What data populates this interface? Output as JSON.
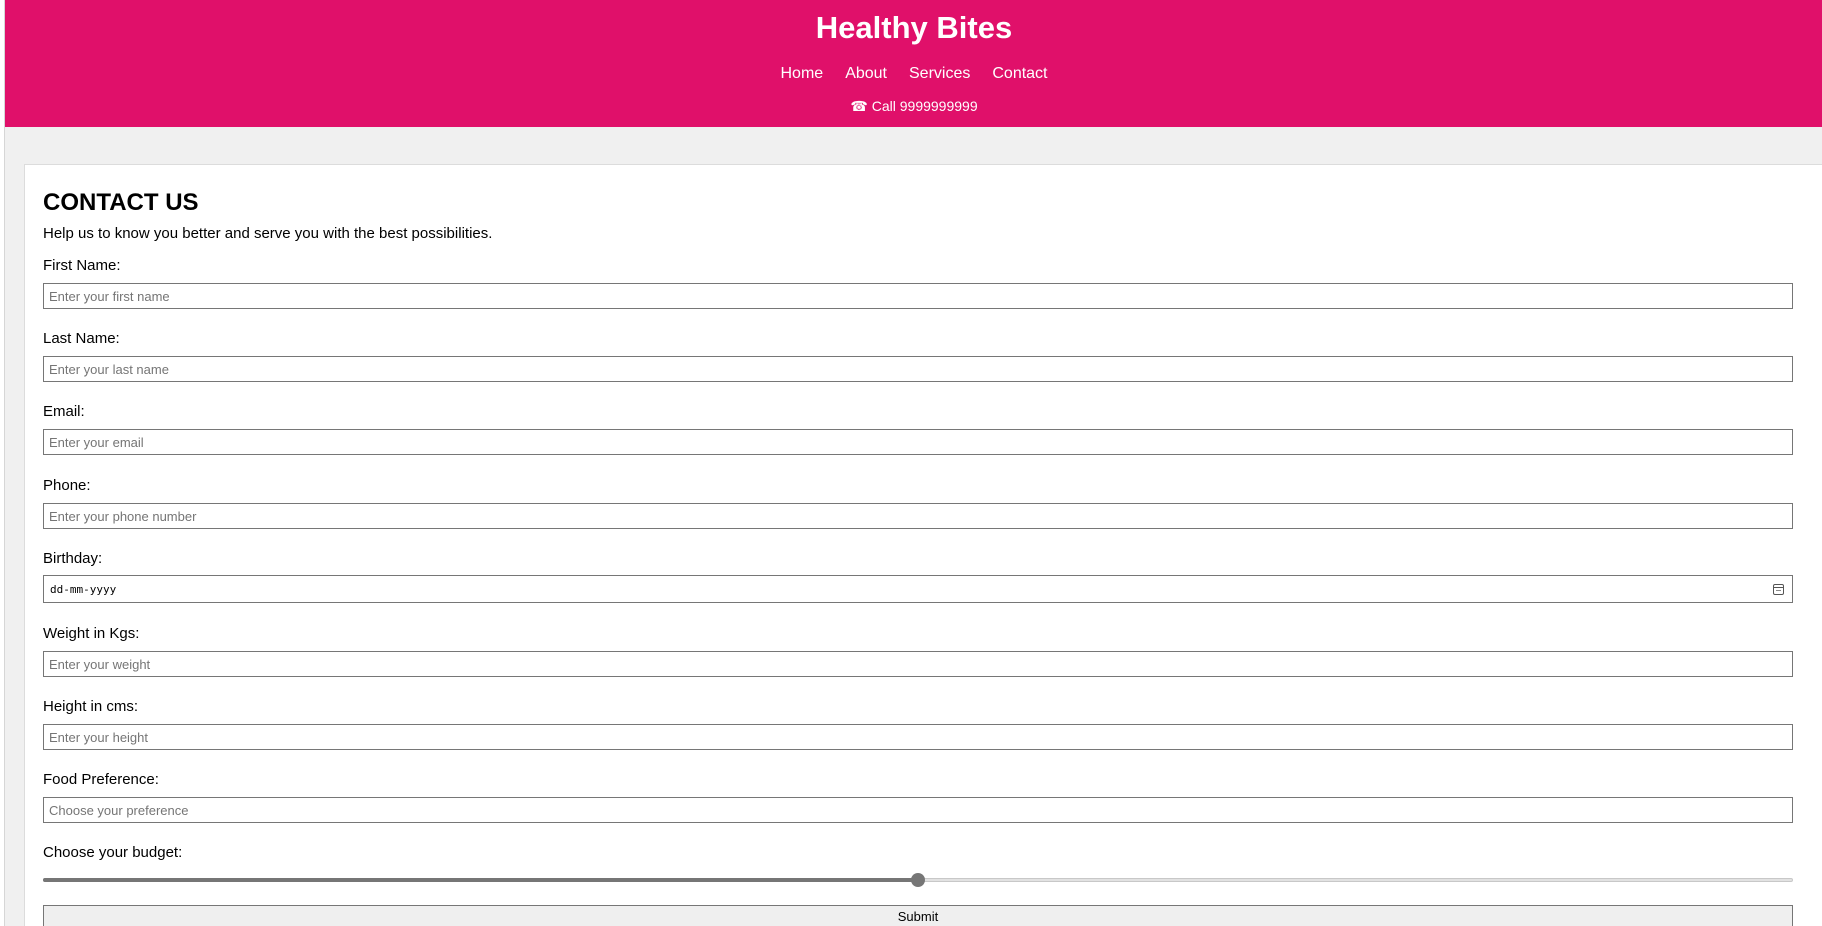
{
  "site": {
    "title": "Healthy Bites",
    "nav": [
      "Home",
      "About",
      "Services",
      "Contact"
    ],
    "phone_icon": "phone-icon",
    "phone_glyph": "☎",
    "call_text": "Call 9999999999"
  },
  "colors": {
    "header_bg": "#e0106a",
    "page_bg": "#f0f0f0"
  },
  "form": {
    "heading": "CONTACT US",
    "intro": "Help us to know you better and serve you with the best possibilities.",
    "first_name": {
      "label": "First Name:",
      "placeholder": "Enter your first name"
    },
    "last_name": {
      "label": "Last Name:",
      "placeholder": "Enter your last name"
    },
    "email": {
      "label": "Email:",
      "placeholder": "Enter your email"
    },
    "phone": {
      "label": "Phone:",
      "placeholder": "Enter your phone number"
    },
    "birthday": {
      "label": "Birthday:",
      "value": "dd-mm-yyyy"
    },
    "weight": {
      "label": "Weight in Kgs:",
      "placeholder": "Enter your weight"
    },
    "height": {
      "label": "Height in cms:",
      "placeholder": "Enter your height"
    },
    "food": {
      "label": "Food Preference:",
      "placeholder": "Choose your preference"
    },
    "budget": {
      "label": "Choose your budget:",
      "value_fraction": 0.5
    },
    "submit_label": "Submit"
  }
}
